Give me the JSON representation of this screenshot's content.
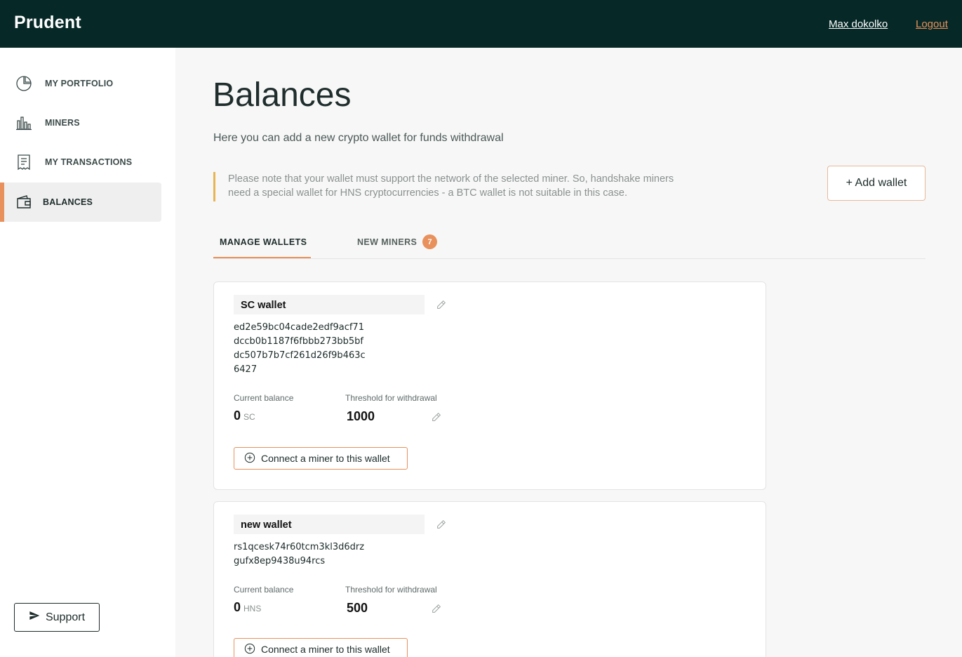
{
  "header": {
    "brand": "Prudent",
    "user_name": "Max dokolko",
    "logout_label": "Logout"
  },
  "sidebar": {
    "items": [
      {
        "label": "MY PORTFOLIO",
        "icon": "pie-chart-icon"
      },
      {
        "label": "MINERS",
        "icon": "bar-chart-icon"
      },
      {
        "label": "MY TRANSACTIONS",
        "icon": "receipt-icon"
      },
      {
        "label": "BALANCES",
        "icon": "wallet-icon",
        "active": true
      }
    ],
    "support_label": "Support"
  },
  "main": {
    "title": "Balances",
    "subtitle": "Here you can add a new crypto wallet for funds withdrawal",
    "notice": "Please note that your wallet must support the network of the selected miner. So, handshake miners need a special wallet for HNS cryptocurrencies - a BTC wallet is not suitable in this case.",
    "add_wallet_label": "+ Add wallet",
    "tabs": [
      {
        "label": "MANAGE WALLETS",
        "active": true
      },
      {
        "label": "NEW MINERS",
        "badge": "7"
      }
    ],
    "wallets": [
      {
        "name": "SC wallet",
        "address_lines": [
          "ed2e59bc04cade2edf9acf71",
          "dccb0b1187f6fbbb273bb5bf",
          "dc507b7b7cf261d26f9b463c",
          "6427"
        ],
        "balance_label": "Current balance",
        "balance": "0",
        "unit": "SC",
        "threshold_label": "Threshold for withdrawal",
        "threshold": "1000",
        "connect_label": "Connect a miner to this wallet"
      },
      {
        "name": "new wallet",
        "address_lines": [
          "rs1qcesk74r60tcm3kl3d6drz",
          "gufx8ep9438u94rcs"
        ],
        "balance_label": "Current balance",
        "balance": "0",
        "unit": "HNS",
        "threshold_label": "Threshold for withdrawal",
        "threshold": "500",
        "connect_label": "Connect a miner to this wallet"
      }
    ]
  },
  "colors": {
    "topbar": "#062826",
    "accent": "#e8915c",
    "notice_border": "#e8b552"
  }
}
